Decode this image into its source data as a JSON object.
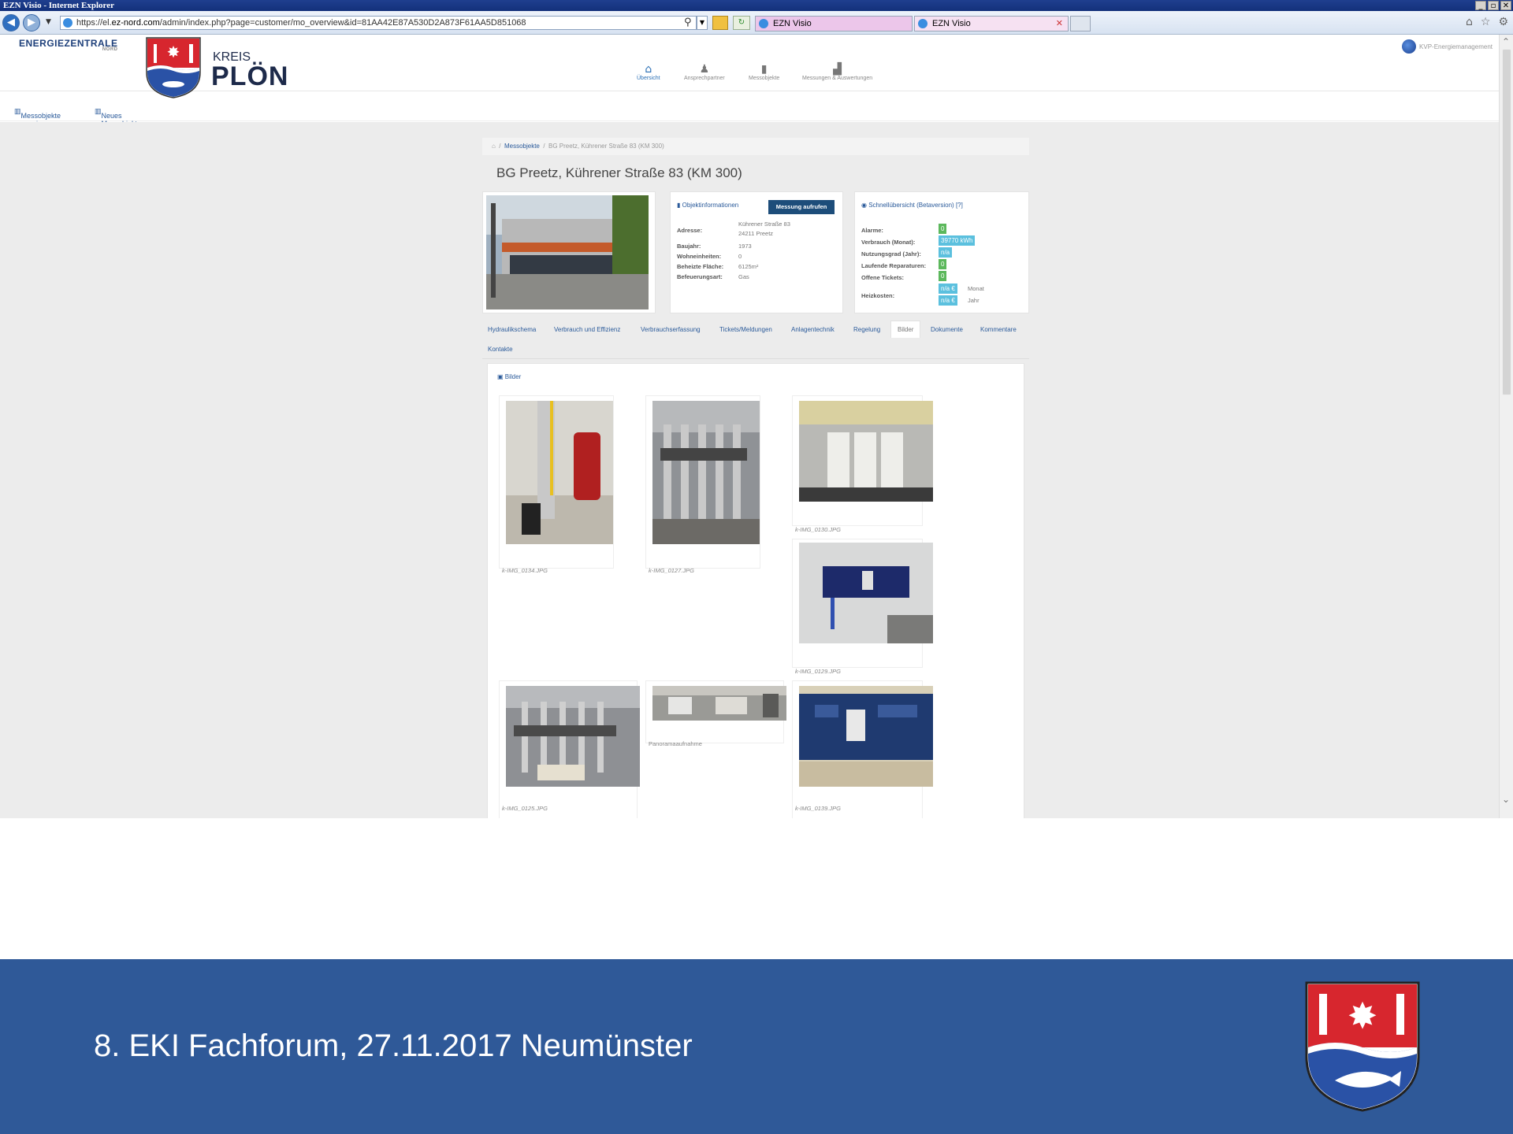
{
  "window": {
    "title": "EZN Visio - Internet Explorer",
    "controls": [
      "_",
      "▫",
      "✕"
    ]
  },
  "browser": {
    "url_prefix": "https://el.",
    "url_domain": "ez-nord.com",
    "url_path": "/admin/index.php?page=customer/mo_overview&id=81AA42E87A530D2A873F61AA5D851068",
    "tabs": [
      {
        "label": "EZN Visio"
      },
      {
        "label": "EZN Visio"
      }
    ],
    "tab_close": "✕"
  },
  "app": {
    "ezn_logo": "ENERGIEZENTRALE",
    "ezn_logo_sub": "NORD",
    "kreis": "KREIS",
    "ploen": "PLÖN",
    "nav": [
      {
        "label": "Übersicht",
        "icon": "home-icon",
        "glyph": "⌂"
      },
      {
        "label": "Ansprechpartner",
        "icon": "person-icon",
        "glyph": "♟"
      },
      {
        "label": "Messobjekte",
        "icon": "building-icon",
        "glyph": "▮"
      },
      {
        "label": "Messungen & Auswertungen",
        "icon": "chart-icon",
        "glyph": "▟"
      }
    ],
    "user": "KVP-Energiemanagement"
  },
  "subbar": {
    "show_objects": "Messobjekte anzeigen",
    "new_object": "Neues Messobjekt"
  },
  "breadcrumb": {
    "home_glyph": "⌂",
    "level1": "Messobjekte",
    "current": "BG Preetz, Kührener Straße 83 (KM 300)"
  },
  "object": {
    "title": "BG Preetz, Kührener Straße 83 (KM 300)",
    "info_header": "Objektinformationen",
    "measure_button": "Messung aufrufen",
    "address_label": "Adresse:",
    "address_line1": "Kührener Straße 83",
    "address_line2": "24211 Preetz",
    "year_label": "Baujahr:",
    "year": "1973",
    "units_label": "Wohneinheiten:",
    "units": "0",
    "area_label": "Beheizte Fläche:",
    "area": "6125m²",
    "fuel_label": "Befeuerungsart:",
    "fuel": "Gas"
  },
  "quick": {
    "header": "Schnellübersicht (Betaversion)",
    "help": "[?]",
    "alarms_label": "Alarme:",
    "alarms": "0",
    "usage_label": "Verbrauch (Monat):",
    "usage": "39770 kWh",
    "efficiency_label": "Nutzungsgrad (Jahr):",
    "efficiency": "n/a",
    "repairs_label": "Laufende Reparaturen:",
    "repairs": "0",
    "tickets_label": "Offene Tickets:",
    "tickets": "0",
    "heating_label": "Heizkosten:",
    "heating_month": "n/a €",
    "heating_month_unit": "Monat",
    "heating_year": "n/a €",
    "heating_year_unit": "Jahr",
    "colors": {
      "green": "#5cb85c",
      "blue": "#5bc0de"
    }
  },
  "tabs": [
    "Hydraulikschema",
    "Verbrauch und Effizienz",
    "Verbrauchserfassung",
    "Tickets/Meldungen",
    "Anlagentechnik",
    "Regelung",
    "Bilder",
    "Dokumente",
    "Kommentare",
    "Kontakte"
  ],
  "gallery": {
    "header": "Bilder",
    "captions": [
      "k-IMG_0134.JPG",
      "k-IMG_0127.JPG",
      "k-IMG_0130.JPG",
      "k-IMG_0129.JPG",
      "k-IMG_0125.JPG",
      "Panoramaaufnahme",
      "k-IMG_0139.JPG"
    ]
  },
  "footer": {
    "text": "8. EKI Fachforum, 27.11.2017 Neumünster",
    "color": "#2f5998"
  }
}
